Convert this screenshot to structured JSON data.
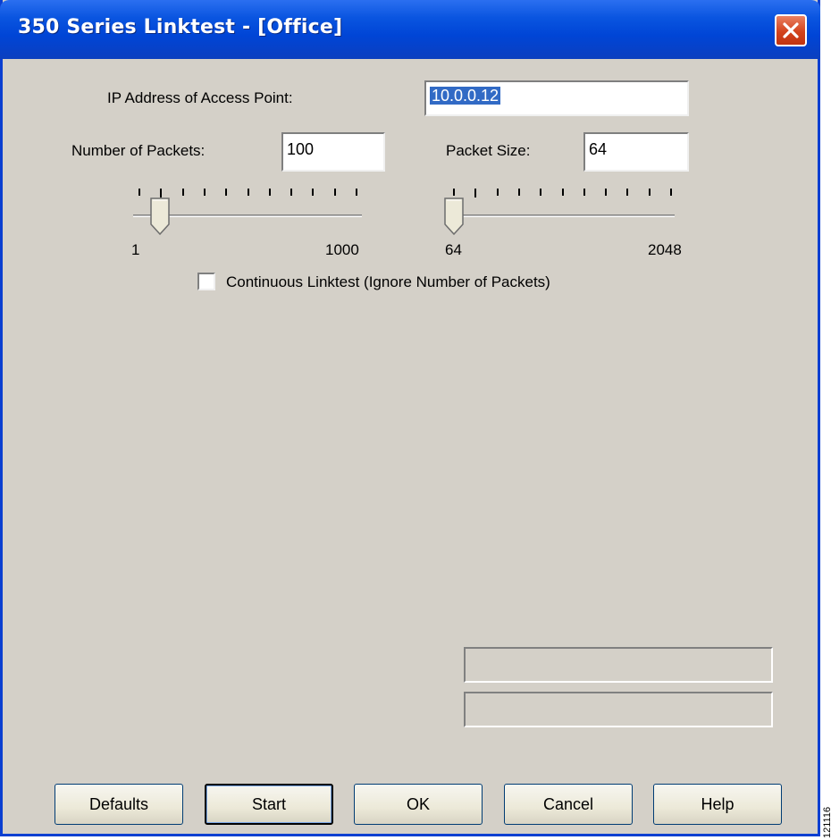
{
  "window": {
    "title": "350 Series Linktest - [Office]",
    "close_icon": "close-icon"
  },
  "ip": {
    "label": "IP Address of Access Point:",
    "value": "10.0.0.12"
  },
  "packets": {
    "label": "Number of Packets:",
    "value": "100",
    "slider_min": "1",
    "slider_max": "1000",
    "slider_value": 100
  },
  "packet_size": {
    "label": "Packet Size:",
    "value": "64",
    "slider_min": "64",
    "slider_max": "2048",
    "slider_value": 64
  },
  "continuous": {
    "label": "Continuous Linktest (Ignore Number of Packets)",
    "checked": false
  },
  "buttons": {
    "defaults": "Defaults",
    "start": "Start",
    "ok": "OK",
    "cancel": "Cancel",
    "help": "Help"
  },
  "figure_id": "121116",
  "colors": {
    "title_bar": "#0a55e0",
    "dialog_bg": "#d4d0c8",
    "close_button": "#d3431d",
    "selection": "#316ac5"
  }
}
